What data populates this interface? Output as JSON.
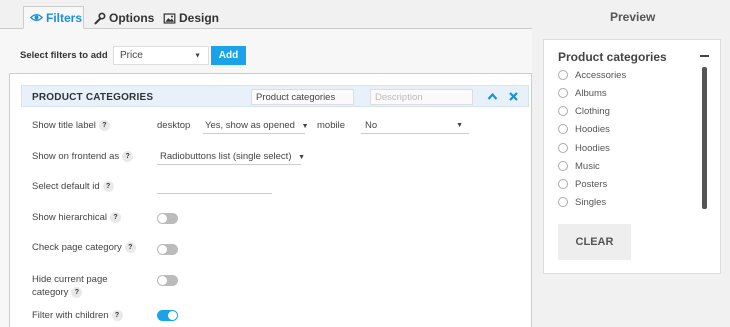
{
  "tabs": [
    {
      "label": "Filters",
      "icon": "eye-icon"
    },
    {
      "label": "Options",
      "icon": "wrench-icon"
    },
    {
      "label": "Design",
      "icon": "image-icon"
    }
  ],
  "preview_title": "Preview",
  "selector": {
    "label": "Select filters to add",
    "value": "Price",
    "add_label": "Add"
  },
  "panel": {
    "title": "PRODUCT CATEGORIES",
    "title_input": "Product categories",
    "description_placeholder": "Description",
    "rows": {
      "show_title_label": "Show title label",
      "desktop_label": "desktop",
      "desktop_value": "Yes, show as opened",
      "mobile_label": "mobile",
      "mobile_value": "No",
      "show_on_frontend": "Show on frontend as",
      "frontend_value": "Radiobuttons list (single select)",
      "select_default_id": "Select default id",
      "show_hierarchical": "Show hierarchical",
      "check_page_category": "Check page category",
      "hide_current_page_category_1": "Hide current page",
      "hide_current_page_category_2": "category",
      "filter_with_children": "Filter with children"
    },
    "help": "?",
    "toggles": {
      "show_hierarchical": false,
      "check_page_category": false,
      "hide_current_page_category": false,
      "filter_with_children": true
    }
  },
  "preview": {
    "title": "Product categories",
    "items": [
      "Accessories",
      "Albums",
      "Clothing",
      "Hoodies",
      "Hoodies",
      "Music",
      "Posters",
      "Singles"
    ],
    "clear_label": "CLEAR"
  },
  "colors": {
    "accent": "#1aa3e8",
    "header_bg": "#e8f1f9"
  }
}
